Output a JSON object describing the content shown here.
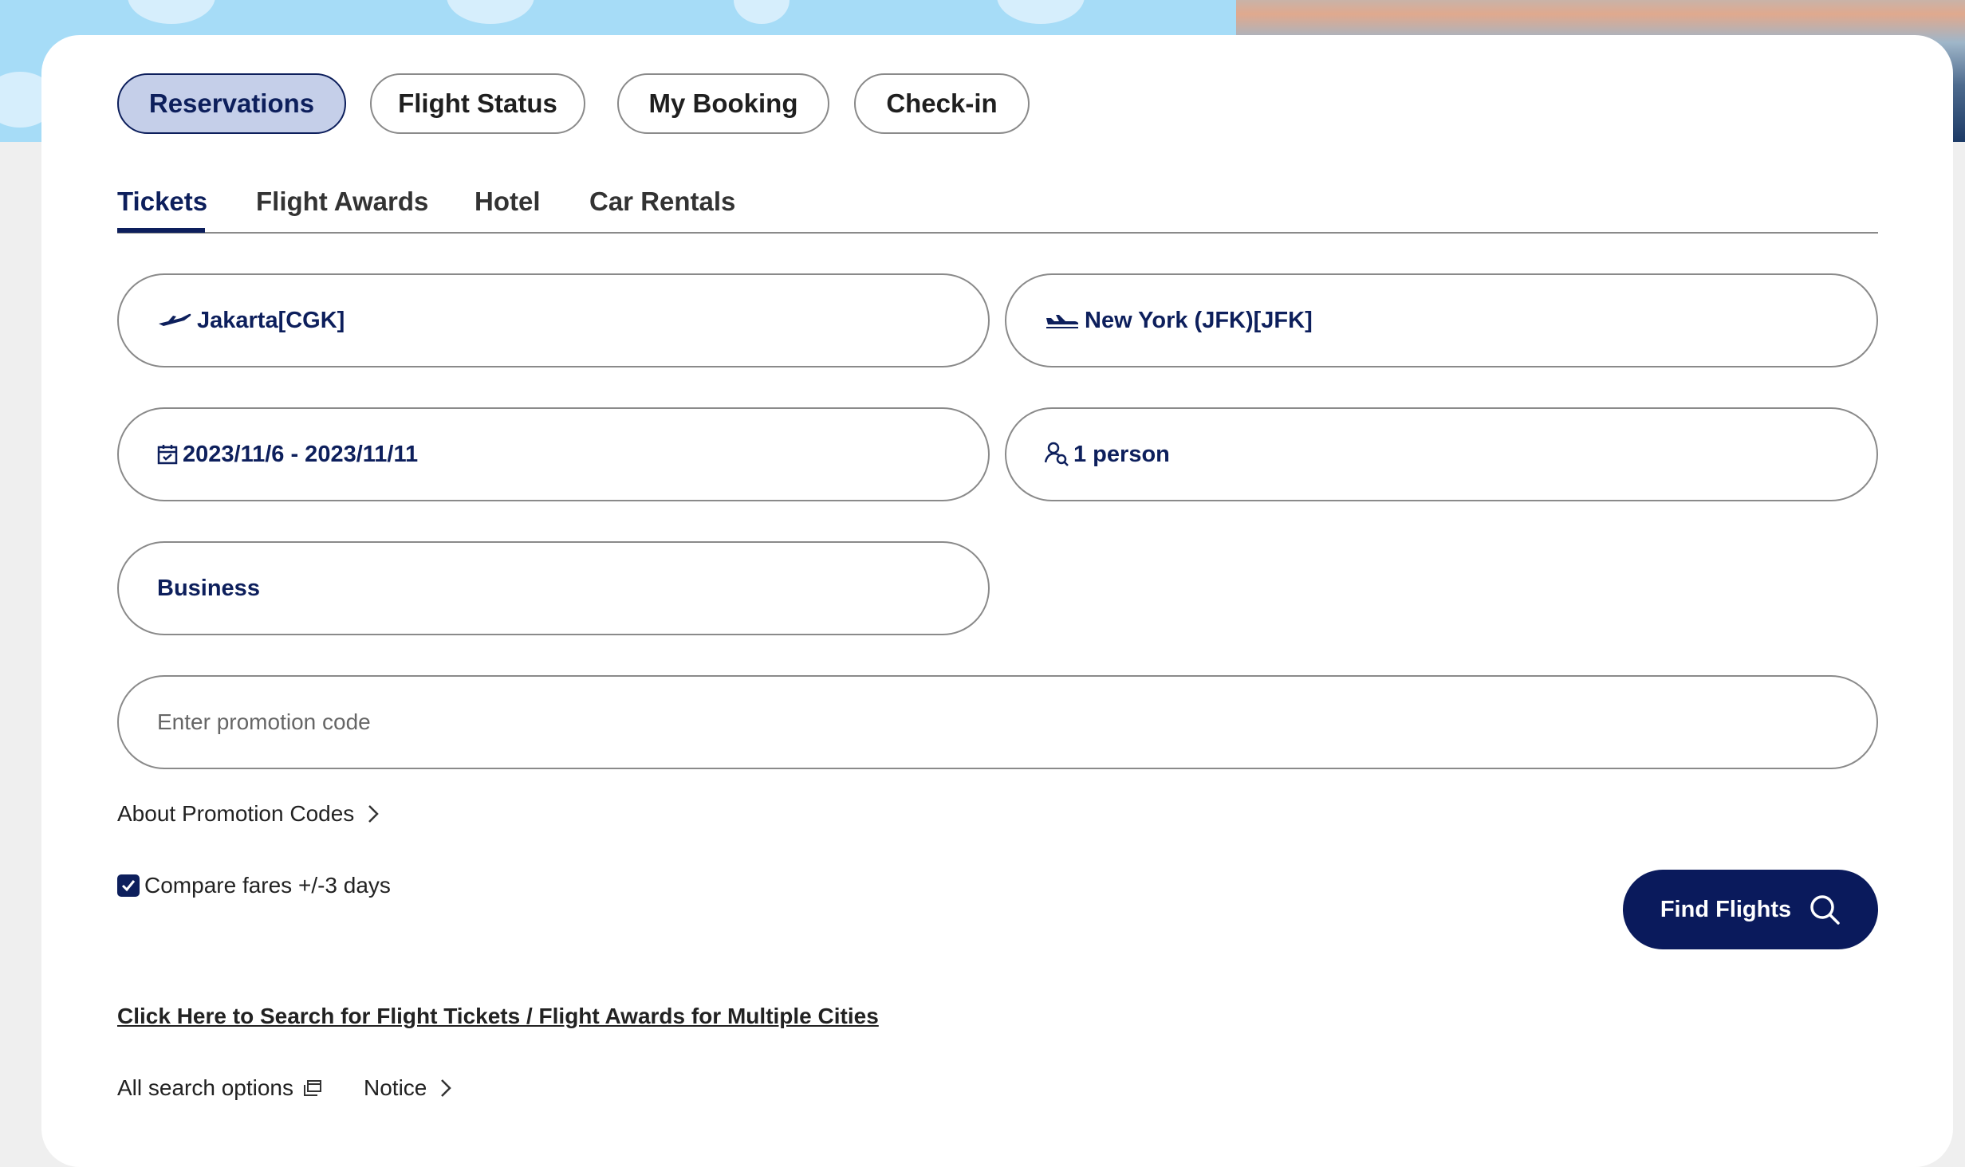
{
  "top_tabs": [
    {
      "label": "Reservations",
      "active": true
    },
    {
      "label": "Flight Status",
      "active": false
    },
    {
      "label": "My Booking",
      "active": false
    },
    {
      "label": "Check-in",
      "active": false
    }
  ],
  "sub_tabs": [
    {
      "label": "Tickets",
      "active": true
    },
    {
      "label": "Flight Awards",
      "active": false
    },
    {
      "label": "Hotel",
      "active": false
    },
    {
      "label": "Car Rentals",
      "active": false
    }
  ],
  "form": {
    "origin": "Jakarta[CGK]",
    "destination": "New York (JFK)[JFK]",
    "dates": "2023/11/6 - 2023/11/11",
    "passengers": "1 person",
    "cabin_class": "Business",
    "promo_placeholder": "Enter promotion code",
    "promo_value": ""
  },
  "links": {
    "about_promo": "About Promotion Codes",
    "compare_fares": "Compare fares +/-3 days",
    "compare_fares_checked": true,
    "multi_city": "Click Here to Search for Flight Tickets / Flight Awards for Multiple Cities",
    "all_search_options": "All search options",
    "notice": "Notice"
  },
  "find_button": "Find Flights",
  "colors": {
    "accent": "#0d1f5c",
    "active_tab_bg": "#c5cfe9",
    "button_bg": "#0a1a5c"
  },
  "icons": {
    "origin": "plane-takeoff-icon",
    "destination": "plane-landing-icon",
    "dates": "calendar-icon",
    "passengers": "person-icon",
    "find": "search-icon"
  }
}
